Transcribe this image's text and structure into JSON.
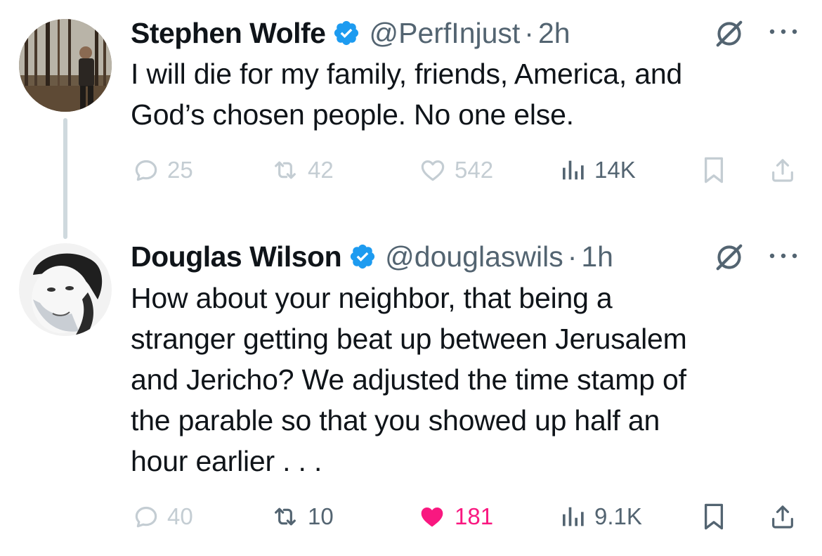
{
  "tweets": [
    {
      "author_name": "Stephen Wolfe",
      "handle": "@PerfInjust",
      "dot": "·",
      "time": "2h",
      "text_lines": [
        "I will die for my family, friends, America, and",
        "God’s chosen people. No one else."
      ],
      "replies": "25",
      "reposts": "42",
      "likes": "542",
      "views": "14K",
      "liked": false
    },
    {
      "author_name": "Douglas Wilson",
      "handle": "@douglaswils",
      "dot": "·",
      "time": "1h",
      "text_lines": [
        "How about your neighbor, that being a",
        "stranger getting beat up between Jerusalem",
        "and Jericho? We adjusted the time stamp of",
        "the parable so that you showed up half an",
        "hour earlier . . ."
      ],
      "replies": "40",
      "reposts": "10",
      "likes": "181",
      "views": "9.1K",
      "liked": true
    }
  ],
  "colors": {
    "verified": "#1d9bf0",
    "secondary_text": "#536471",
    "like_active": "#f91880",
    "thread_line": "#cfd9de"
  },
  "icons": [
    "verified-badge-icon",
    "grok-icon",
    "more-icon",
    "reply-icon",
    "repost-icon",
    "like-icon",
    "views-icon",
    "bookmark-icon",
    "share-icon"
  ]
}
